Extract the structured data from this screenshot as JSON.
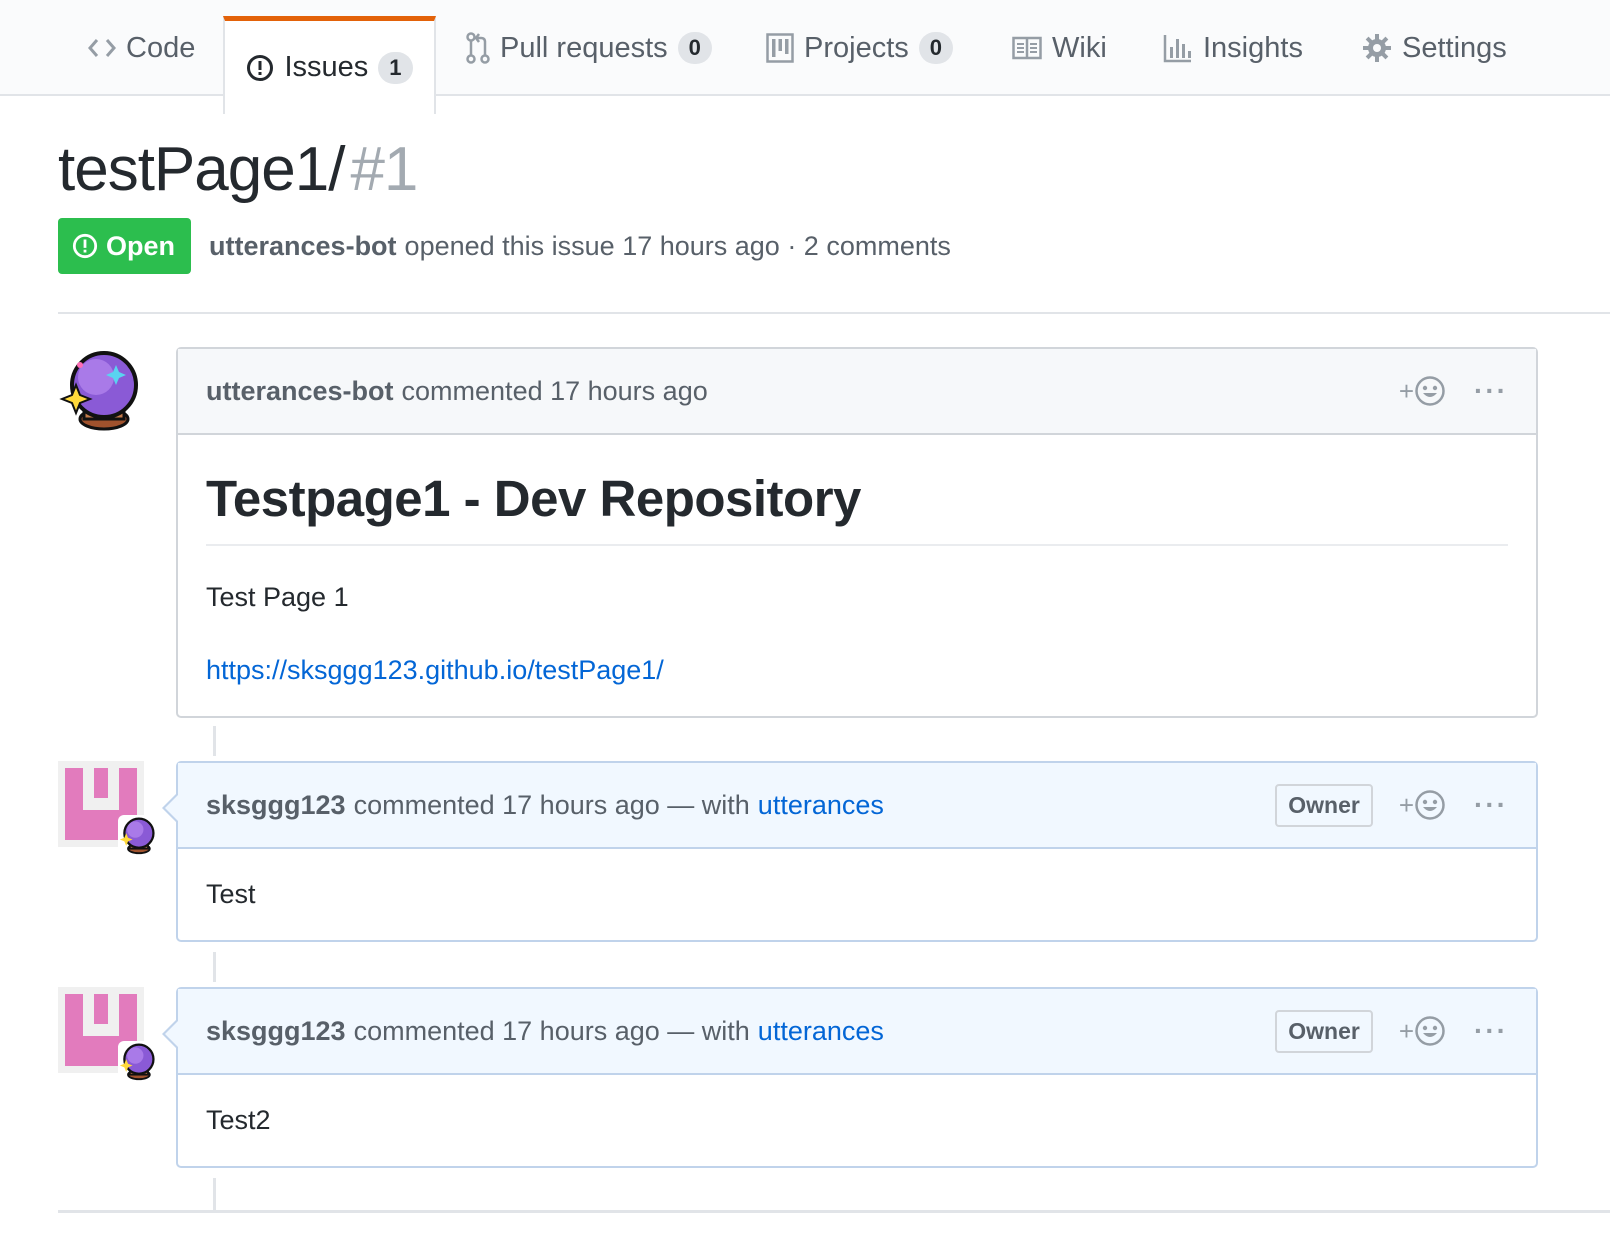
{
  "nav": {
    "code": {
      "label": "Code"
    },
    "issues": {
      "label": "Issues",
      "count": "1"
    },
    "pulls": {
      "label": "Pull requests",
      "count": "0"
    },
    "projects": {
      "label": "Projects",
      "count": "0"
    },
    "wiki": {
      "label": "Wiki"
    },
    "insights": {
      "label": "Insights"
    },
    "settings": {
      "label": "Settings"
    }
  },
  "issue": {
    "title": "testPage1/",
    "number": "#1",
    "state": "Open",
    "author": "utterances-bot",
    "meta_text": "opened this issue 17 hours ago · 2 comments"
  },
  "comments": [
    {
      "login": "utterances-bot",
      "header_text": "commented 17 hours ago",
      "body_heading": "Testpage1 - Dev Repository",
      "body_text": "Test Page 1",
      "body_link": "https://sksggg123.github.io/testPage1/"
    },
    {
      "login": "sksggg123",
      "header_text": "commented 17 hours ago — with",
      "with_link": "utterances",
      "role": "Owner",
      "body_text": "Test"
    },
    {
      "login": "sksggg123",
      "header_text": "commented 17 hours ago — with",
      "with_link": "utterances",
      "role": "Owner",
      "body_text": "Test2"
    }
  ],
  "reaction_plus": "+",
  "more_glyph": "···",
  "colors": {
    "open_green": "#2cbe4e",
    "tab_accent": "#e36209",
    "link_blue": "#0366d6",
    "owner_header_bg": "#f1f8ff",
    "identicon_pink": "#e27bbd"
  }
}
